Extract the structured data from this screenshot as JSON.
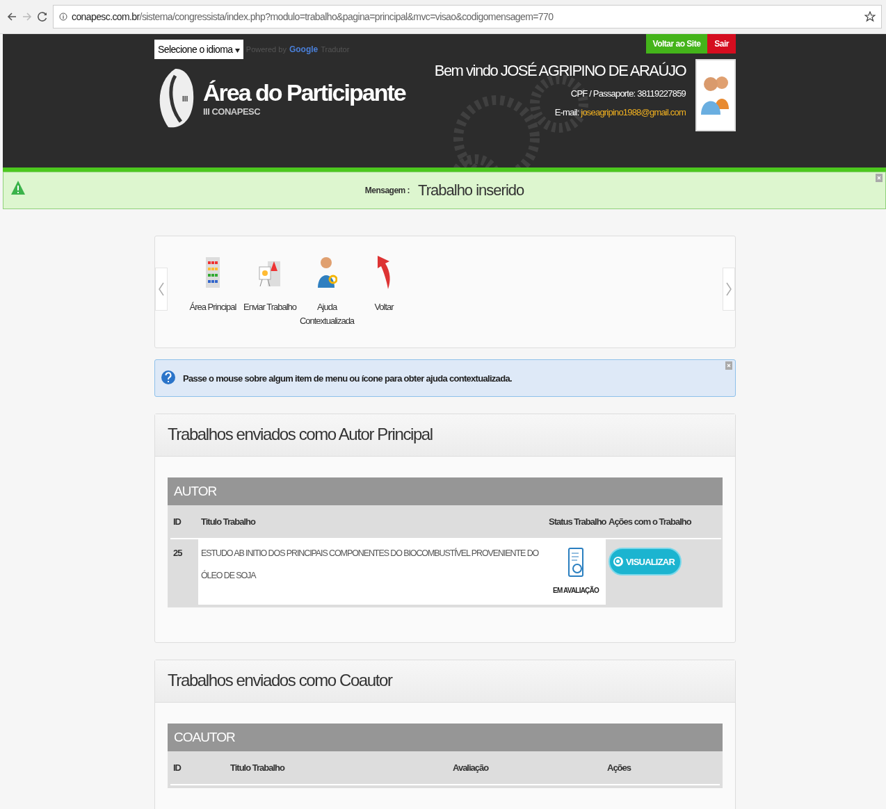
{
  "browser": {
    "url_host": "conapesc.com.br",
    "url_path": "/sistema/congressista/index.php?modulo=trabalho&pagina=principal&mvc=visao&codigomensagem=770"
  },
  "header": {
    "language_select": "Selecione o idioma",
    "powered_by": "Powered by",
    "google": "Google",
    "translator": "Tradutor",
    "title": "Área do Participante",
    "subtitle": "III CONAPESC",
    "logo_mark": "III",
    "buttons": [
      {
        "label": "Voltar ao Site",
        "kind": "back"
      },
      {
        "label": "Sair",
        "kind": "exit"
      }
    ],
    "welcome": "Bem vindo JOSÉ AGRIPINO DE ARAÚJO",
    "cpf": "CPF / Passaporte: 38119227859",
    "email_label": "E-mail:",
    "email": "joseagripino1988@gmail.com"
  },
  "message": {
    "label": "Mensagem :",
    "text": "Trabalho inserido"
  },
  "toolbar": [
    {
      "label": "Área Principal",
      "kind": "grid"
    },
    {
      "label": "Enviar Trabalho",
      "kind": "chart"
    },
    {
      "label": "Ajuda Contextualizada",
      "kind": "help"
    },
    {
      "label": "Voltar",
      "kind": "back"
    }
  ],
  "help_notice": "Passe o mouse sobre algum item de menu ou ícone para obter ajuda contextualizada.",
  "sections": [
    {
      "title": "Trabalhos enviados como Autor Principal",
      "table_title": "AUTOR",
      "columns": [
        "ID",
        "Titulo Trabalho",
        "Status Trabalho",
        "Ações com o Trabalho"
      ],
      "rows": [
        {
          "id": "25",
          "title": "ESTUDO AB INITIO DOS PRINCIPAIS COMPONENTES DO BIOCOMBUSTÍVEL PROVENIENTE DO ÓLEO DE SOJA",
          "status": "EM AVALIAÇÃO",
          "action": "VISUALIZAR"
        }
      ]
    },
    {
      "title": "Trabalhos enviados como Coautor",
      "table_title": "COAUTOR",
      "columns": [
        "ID",
        "Titulo Trabalho",
        "Avaliação",
        "Ações"
      ]
    }
  ]
}
